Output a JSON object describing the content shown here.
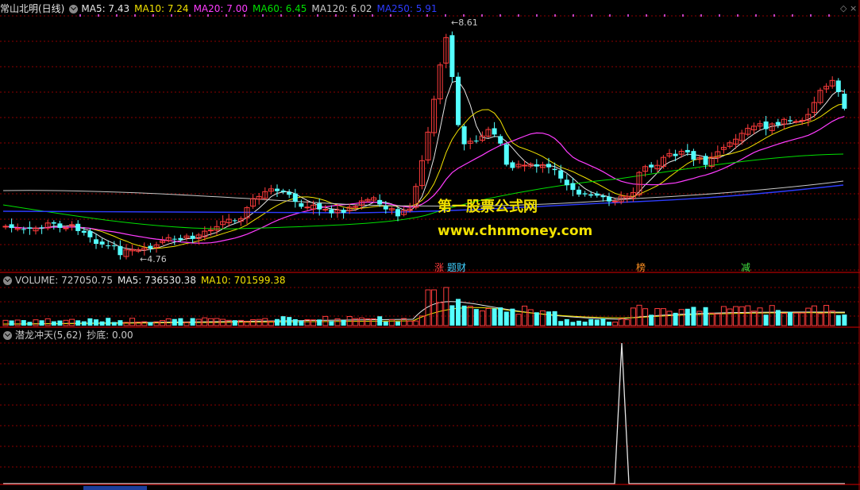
{
  "main_panel": {
    "title": "常山北明(日线)",
    "ma": [
      {
        "label": "MA5: 7.43",
        "color": "#e6e6e6"
      },
      {
        "label": "MA10: 7.24",
        "color": "#f2e200"
      },
      {
        "label": "MA20: 7.00",
        "color": "#ff3cff"
      },
      {
        "label": "MA60: 6.45",
        "color": "#00e000"
      },
      {
        "label": "MA120: 6.02",
        "color": "#c8c8c8"
      },
      {
        "label": "MA250: 5.91",
        "color": "#2d3cff"
      }
    ],
    "high_label": "8.61",
    "low_label": "4.76",
    "event_tags": [
      {
        "text": "涨",
        "color": "#ff3c3c"
      },
      {
        "text": "题财",
        "color": "#40d0ff"
      },
      {
        "text": "榜",
        "color": "#ff9020"
      },
      {
        "text": "减",
        "color": "#40e040"
      }
    ],
    "watermark": {
      "line1": "第一股票公式网",
      "line2": "www.chnmoney.com"
    }
  },
  "volume_panel": {
    "label": "VOLUME: 727050.75",
    "ma5": "MA5: 736530.38",
    "ma10": "MA10: 701599.38"
  },
  "indicator_panel": {
    "label": "潜龙冲天(5,62)",
    "value": "抄底: 0.00"
  },
  "colors": {
    "up": "#ff3c3c",
    "down": "#54ffff",
    "grid": "#8b0000",
    "background": "#000000"
  },
  "icons": [
    "chevron-down-icon",
    "diamond-icon",
    "close-icon"
  ]
}
